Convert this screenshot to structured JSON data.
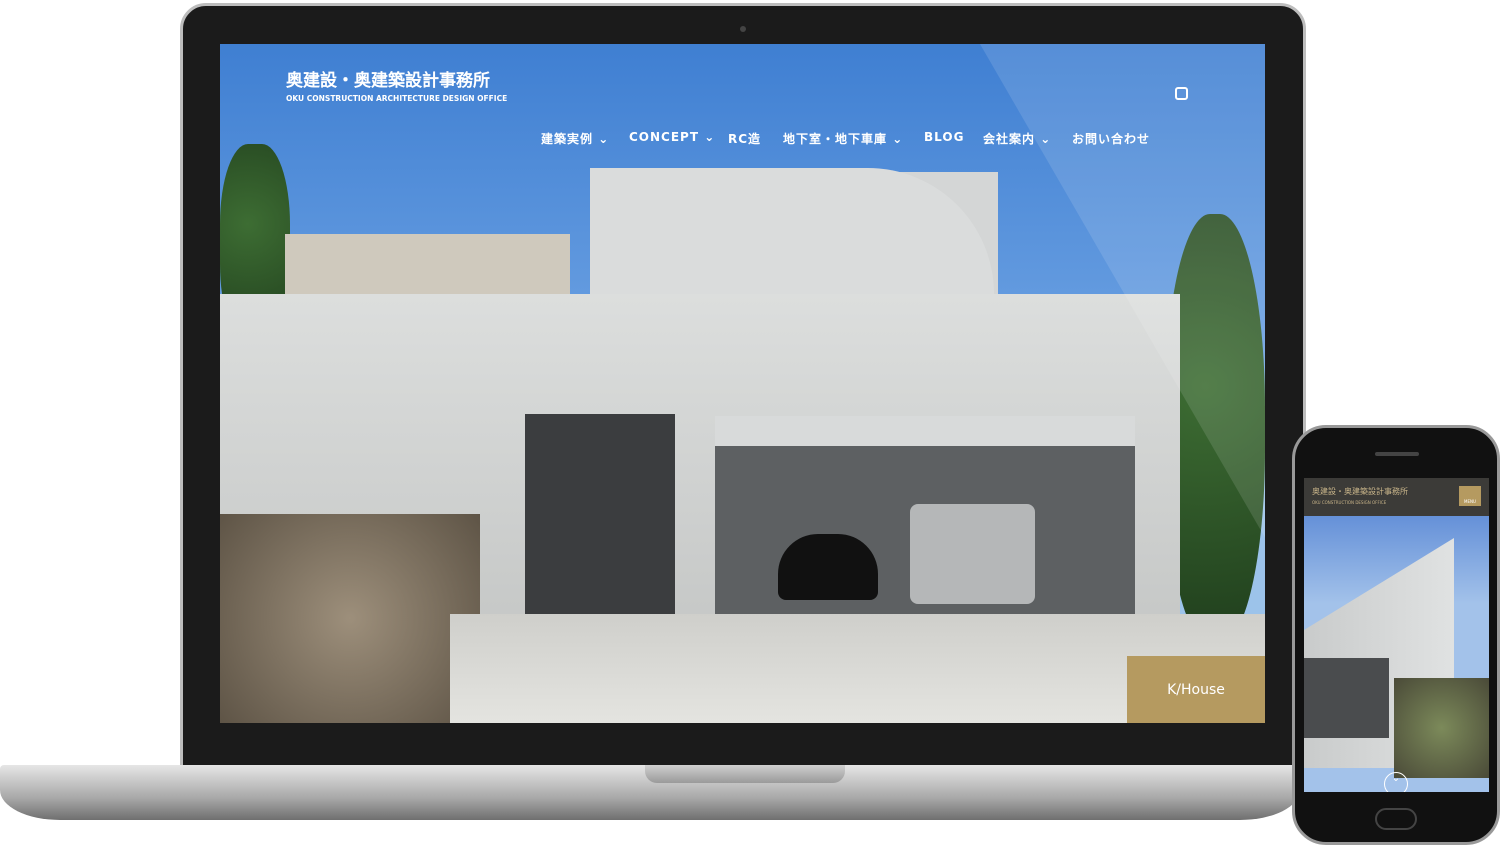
{
  "laptop_site": {
    "logo_jp": "奥建設・奥建築設計事務所",
    "logo_en": "OKU CONSTRUCTION ARCHITECTURE DESIGN OFFICE",
    "nav": [
      {
        "label": "建築実例",
        "has_dropdown": true
      },
      {
        "label": "CONCEPT",
        "has_dropdown": true
      },
      {
        "label": "RC造",
        "has_dropdown": false
      },
      {
        "label": "地下室・地下車庫",
        "has_dropdown": true
      },
      {
        "label": "BLOG",
        "has_dropdown": false
      },
      {
        "label": "会社案内",
        "has_dropdown": true
      },
      {
        "label": "お問い合わせ",
        "has_dropdown": false
      }
    ],
    "social_icon": "instagram-icon",
    "hero_caption": "K/House",
    "accent": "#b59a60"
  },
  "phone_site": {
    "logo_jp": "奥建設・奥建築設計事務所",
    "logo_en": "OKU CONSTRUCTION DESIGN OFFICE",
    "menu_label": "MENU",
    "scroll_icon": "chevron-down-icon"
  }
}
